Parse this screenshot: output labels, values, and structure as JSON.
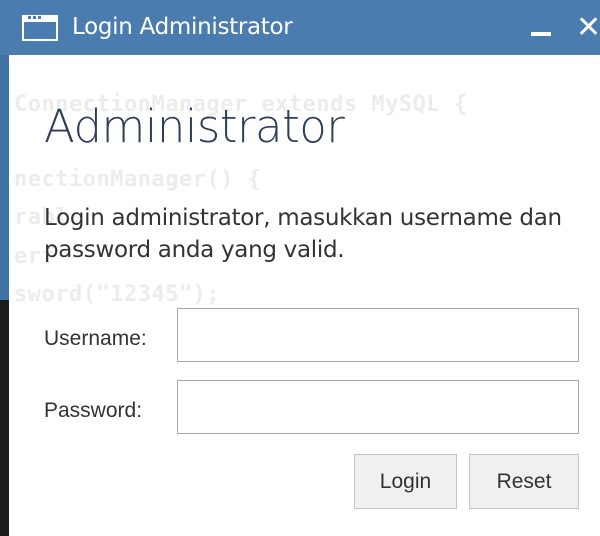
{
  "window": {
    "title": "Login Administrator",
    "minimize_label": "minimize",
    "close_glyph": "✕"
  },
  "background_code": [
    "ConnectionManager extends MySQL {",
    "nectionManager() {",
    "rabl",
    "erf",
    "sword(\"12345\");"
  ],
  "main": {
    "heading": "Administrator",
    "description": "Login administrator, masukkan username dan password anda yang valid."
  },
  "form": {
    "username_label": "Username:",
    "username_value": "",
    "password_label": "Password:",
    "password_value": ""
  },
  "buttons": {
    "login": "Login",
    "reset": "Reset"
  },
  "colors": {
    "titlebar": "#4a7cb0",
    "heading": "#2d3e58",
    "text": "#333333"
  },
  "icons": [
    "window-icon",
    "minimize-icon",
    "close-icon"
  ]
}
